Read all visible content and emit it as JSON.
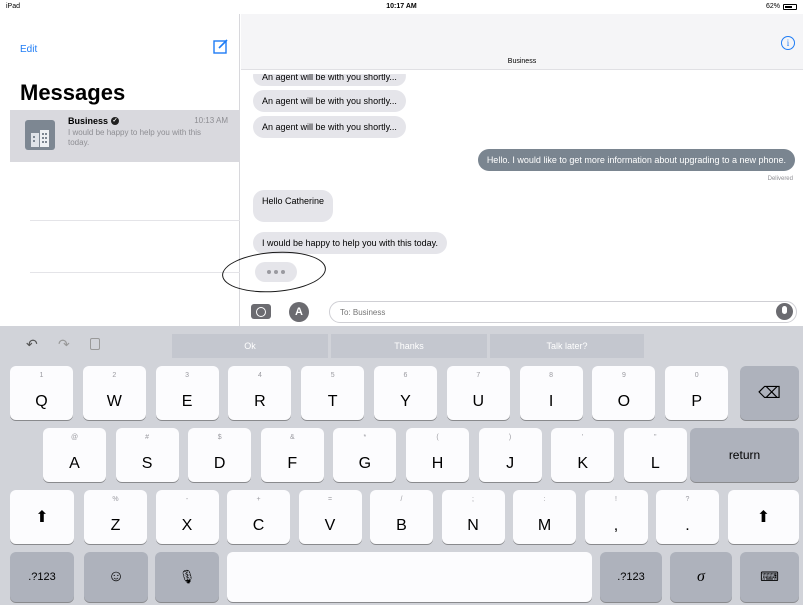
{
  "status": {
    "device": "iPad",
    "time": "10:17 AM",
    "battery": "62%"
  },
  "sidebar": {
    "edit_label": "Edit",
    "title": "Messages",
    "conversation": {
      "name": "Business",
      "time": "10:13 AM",
      "preview": "I would be happy to help you with this today."
    }
  },
  "chat": {
    "title": "Business",
    "messages": [
      {
        "direction": "in",
        "text": "An agent will be with you shortly..."
      },
      {
        "direction": "in",
        "text": "An agent will be with you shortly..."
      },
      {
        "direction": "in",
        "text": "An agent will be with you shortly..."
      },
      {
        "direction": "out",
        "text": "Hello. I would like to get more information about upgrading to a new phone."
      },
      {
        "direction": "in",
        "text": "Hello Catherine"
      },
      {
        "direction": "in",
        "text": "I would be happy to help you with this today."
      }
    ],
    "delivered_label": "Delivered",
    "input_placeholder": "To: Business"
  },
  "keyboard": {
    "suggestions": [
      "Ok",
      "Thanks",
      "Talk later?"
    ],
    "row1": [
      {
        "main": "Q",
        "sub": "1"
      },
      {
        "main": "W",
        "sub": "2"
      },
      {
        "main": "E",
        "sub": "3"
      },
      {
        "main": "R",
        "sub": "4"
      },
      {
        "main": "T",
        "sub": "5"
      },
      {
        "main": "Y",
        "sub": "6"
      },
      {
        "main": "U",
        "sub": "7"
      },
      {
        "main": "I",
        "sub": "8"
      },
      {
        "main": "O",
        "sub": "9"
      },
      {
        "main": "P",
        "sub": "0"
      }
    ],
    "row2": [
      {
        "main": "A",
        "sub": "@"
      },
      {
        "main": "S",
        "sub": "#"
      },
      {
        "main": "D",
        "sub": "$"
      },
      {
        "main": "F",
        "sub": "&"
      },
      {
        "main": "G",
        "sub": "*"
      },
      {
        "main": "H",
        "sub": "("
      },
      {
        "main": "J",
        "sub": ")"
      },
      {
        "main": "K",
        "sub": "'"
      },
      {
        "main": "L",
        "sub": "\""
      }
    ],
    "row3": [
      {
        "main": "Z",
        "sub": "%"
      },
      {
        "main": "X",
        "sub": "-"
      },
      {
        "main": "C",
        "sub": "+"
      },
      {
        "main": "V",
        "sub": "="
      },
      {
        "main": "B",
        "sub": "/"
      },
      {
        "main": "N",
        "sub": ";"
      },
      {
        "main": "M",
        "sub": ":"
      },
      {
        "main": ",",
        "sub": "!"
      },
      {
        "main": ".",
        "sub": "?"
      }
    ],
    "return_label": "return",
    "numbers_label": ".?123",
    "icons": {
      "backspace": "backspace-icon",
      "shift": "shift-icon",
      "emoji": "emoji-icon",
      "mic": "microphone-icon",
      "handwriting": "handwriting-icon",
      "dismiss": "keyboard-dismiss-icon"
    }
  }
}
